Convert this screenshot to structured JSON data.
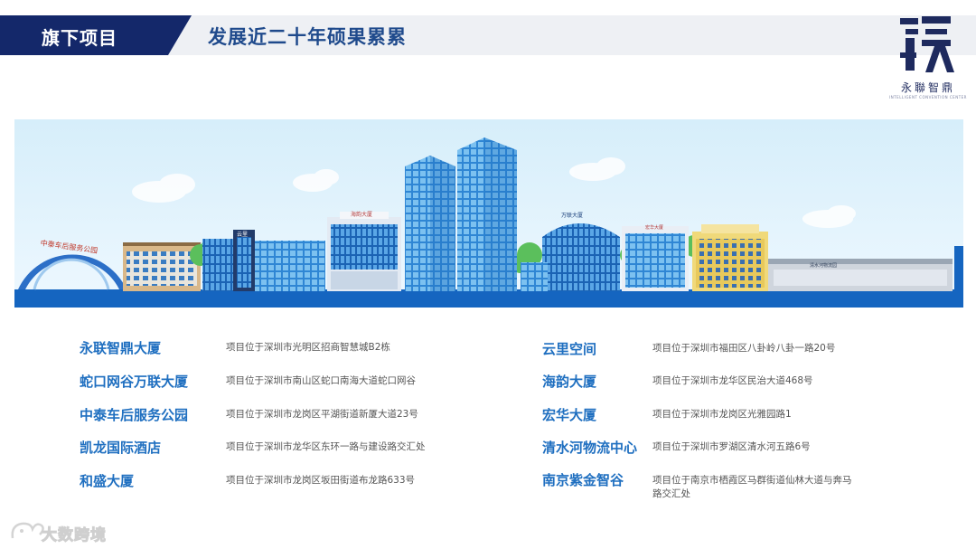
{
  "header": {
    "tag": "旗下项目",
    "title": "发展近二十年硕果累累"
  },
  "logo": {
    "name": "永聯智鼎",
    "subtitle": "INTELLIGENT CONVENTION CENTER",
    "colors": {
      "primary": "#1e2a5e"
    }
  },
  "banner": {
    "signs": {
      "gate": "中泰车后服务公园",
      "yunli": "云里",
      "haiyun": "海韵大厦",
      "wanlian": "万联大厦",
      "honghua": "宏华大厦",
      "logistics": "清水河物流园"
    },
    "colors": {
      "sky": "#dff1fb",
      "ground": "#1565c0",
      "glass": "#3f8fd6"
    }
  },
  "projects_left": [
    {
      "name": "永联智鼎大厦",
      "address": "项目位于深圳市光明区招商智慧城B2栋"
    },
    {
      "name": "蛇口网谷万联大厦",
      "address": "项目位于深圳市南山区蛇口南海大道蛇口网谷"
    },
    {
      "name": "中泰车后服务公园",
      "address": "项目位于深圳市龙岗区平湖街道新厦大道23号"
    },
    {
      "name": "凯龙国际酒店",
      "address": "项目位于深圳市龙华区东环一路与建设路交汇处"
    },
    {
      "name": "和盛大厦",
      "address": "项目位于深圳市龙岗区坂田街道布龙路633号"
    }
  ],
  "projects_right": [
    {
      "name": "云里空间",
      "address": "项目位于深圳市福田区八卦岭八卦一路20号"
    },
    {
      "name": "海韵大厦",
      "address": "项目位于深圳市龙华区民治大道468号"
    },
    {
      "name": "宏华大厦",
      "address": "项目位于深圳市龙岗区光雅园路1"
    },
    {
      "name": "清水河物流中心",
      "address": "项目位于深圳市罗湖区清水河五路6号"
    },
    {
      "name": "南京紫金智谷",
      "address_line1": "项目位于南京市栖霞区马群街道仙林大道与奔马",
      "address_line2": "路交汇处"
    }
  ],
  "watermark": {
    "text": "大数跨境"
  }
}
